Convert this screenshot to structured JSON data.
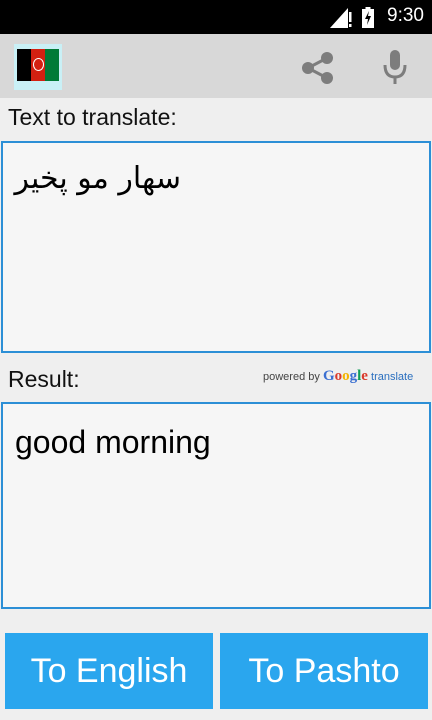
{
  "status_bar": {
    "time": "9:30"
  },
  "action_bar": {
    "flag_icon": "afghanistan-flag-icon",
    "share_icon": "share-icon",
    "mic_icon": "microphone-icon"
  },
  "input": {
    "label": "Text to translate:",
    "value": "سهار مو پخير"
  },
  "result": {
    "label": "Result:",
    "powered_by": "powered by",
    "google_wordmark": "Google",
    "translate_word": "translate",
    "value": "good morning"
  },
  "buttons": {
    "to_english": "To English",
    "to_pashto": "To Pashto"
  },
  "colors": {
    "accent_blue": "#2aa6ee",
    "border_blue": "#2c8fd6",
    "action_bar": "#d8d8d8"
  }
}
